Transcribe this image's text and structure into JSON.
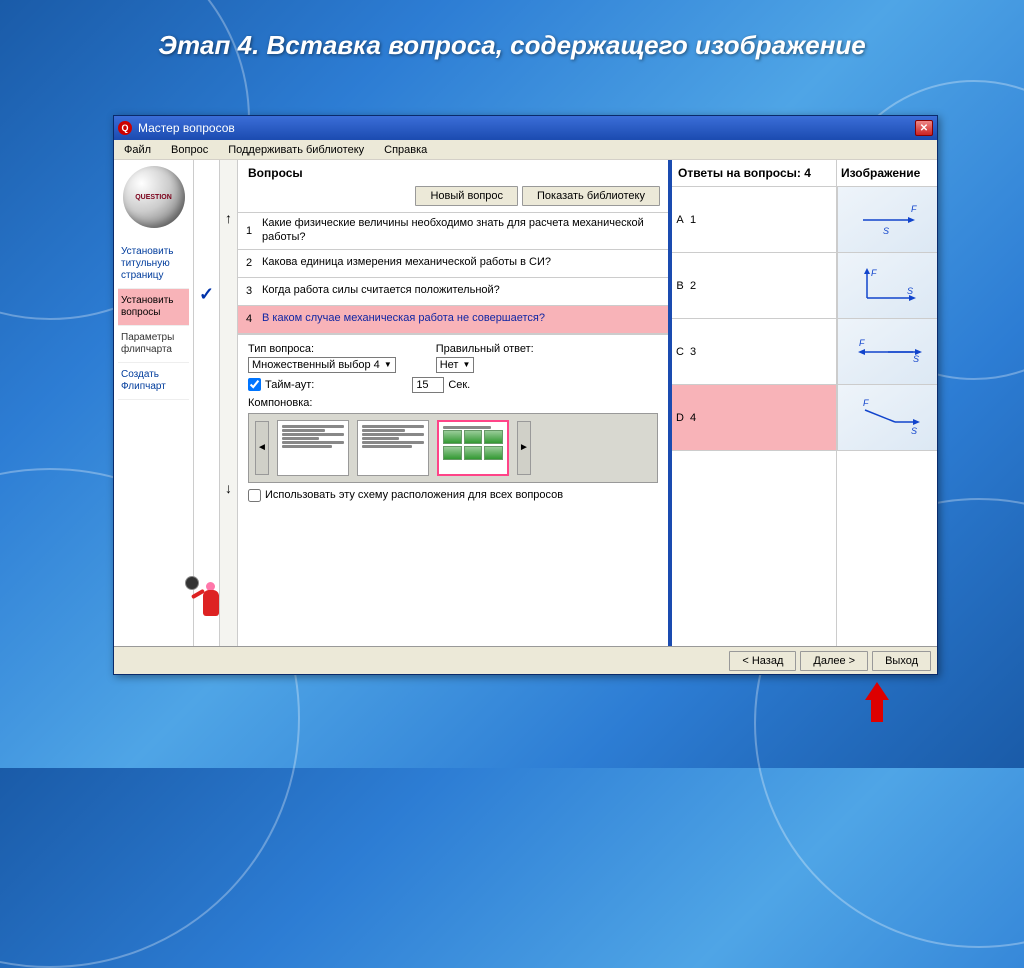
{
  "page": {
    "title": "Этап 4. Вставка вопроса, содержащего изображение"
  },
  "window": {
    "title": "Мастер вопросов",
    "close_label": "✕"
  },
  "menu": {
    "file": "Файл",
    "question": "Вопрос",
    "support_lib": "Поддерживать библиотеку",
    "help": "Справка"
  },
  "sidebar": {
    "logo_text": "QUESTION",
    "items": [
      {
        "label": "Установить титульную страницу",
        "cls": "blue"
      },
      {
        "label": "Установить вопросы",
        "cls": "selected"
      },
      {
        "label": "Параметры флипчарта",
        "cls": ""
      },
      {
        "label": "Создать Флипчарт",
        "cls": "blue"
      }
    ]
  },
  "questions": {
    "header": "Вопросы",
    "new_btn": "Новый вопрос",
    "lib_btn": "Показать библиотеку",
    "list": [
      {
        "num": "1",
        "text": "Какие физические величины необходимо знать для расчета механической работы?"
      },
      {
        "num": "2",
        "text": "Какова единица измерения  механической работы в СИ?"
      },
      {
        "num": "3",
        "text": "Когда работа силы считается положительной?"
      },
      {
        "num": "4",
        "text": "В каком случае механическая работа не совершается?"
      }
    ],
    "selected_index": 3
  },
  "params": {
    "type_label": "Тип вопроса:",
    "type_value": "Множественный выбор 4",
    "correct_label": "Правильный ответ:",
    "correct_value": "Нет",
    "timeout_label": "Тайм-аут:",
    "timeout_value": "15",
    "timeout_unit": "Сек.",
    "layout_label": "Компоновка:",
    "apply_all": "Использовать эту схему расположения для всех вопросов"
  },
  "answers": {
    "header": "Ответы на вопросы: 4",
    "img_header": "Изображение",
    "rows": [
      {
        "letter": "A",
        "num": "1"
      },
      {
        "letter": "B",
        "num": "2"
      },
      {
        "letter": "C",
        "num": "3"
      },
      {
        "letter": "D",
        "num": "4"
      }
    ],
    "selected_index": 3
  },
  "footer": {
    "back": "< Назад",
    "next": "Далее >",
    "exit": "Выход"
  }
}
